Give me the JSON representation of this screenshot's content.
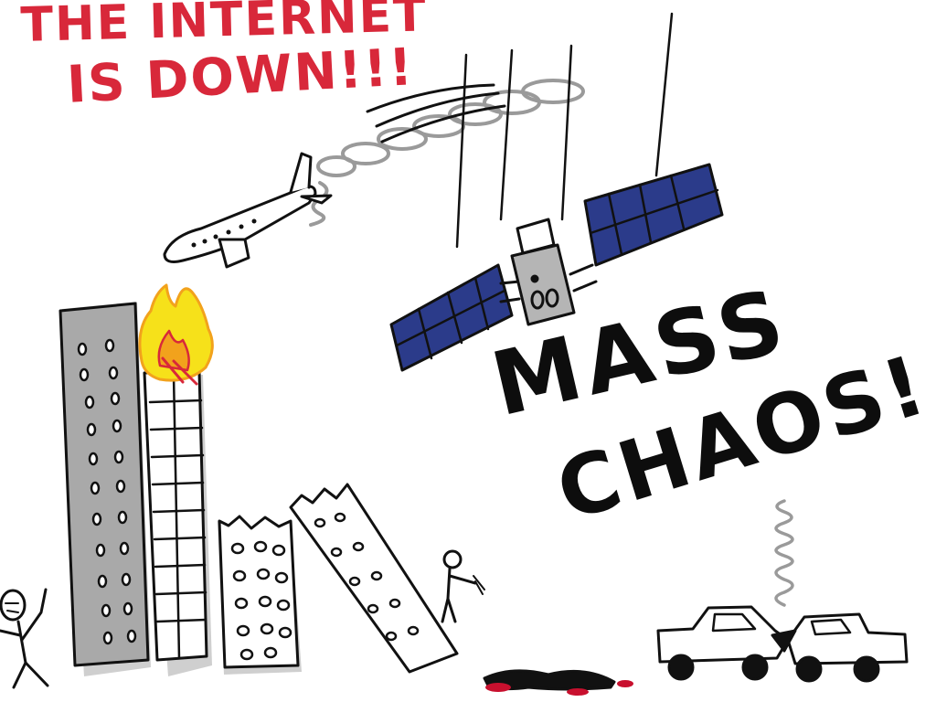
{
  "headline": {
    "line1": "THE INTERNET",
    "line2": "IS DOWN!!!",
    "color": "#d8283a"
  },
  "caption": {
    "line1": "MASS",
    "line2": "CHAOS!",
    "color": "#0d0d0d"
  },
  "palette": {
    "ink": "#111111",
    "building_gray": "#a9a9a9",
    "shadow_gray": "#cfcfcf",
    "fire_yellow": "#f6e11a",
    "fire_orange": "#f2a21c",
    "fire_red": "#d8283a",
    "solar_panel_blue": "#2b3b8a",
    "smoke_gray": "#9a9a9a",
    "blood_red": "#c8102e"
  }
}
